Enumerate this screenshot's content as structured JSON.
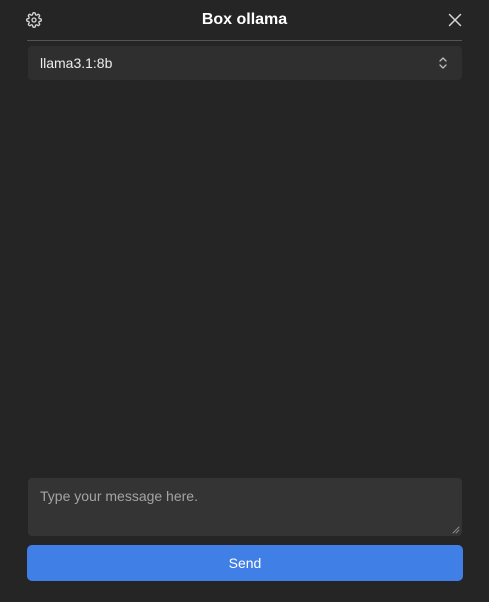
{
  "header": {
    "title": "Box ollama",
    "settings_icon": "gear-icon",
    "close_icon": "close-icon"
  },
  "model_select": {
    "selected": "llama3.1:8b",
    "icon": "chevron-up-down-icon"
  },
  "composer": {
    "placeholder": "Type your message here.",
    "value": "",
    "send_label": "Send"
  },
  "colors": {
    "background": "#252525",
    "select_background": "#2f2f2f",
    "input_background": "#343434",
    "accent": "#3f7fe6",
    "divider": "#545454"
  }
}
